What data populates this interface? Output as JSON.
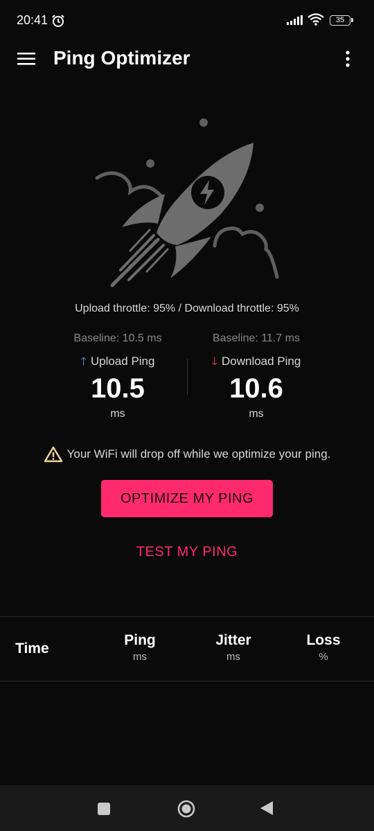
{
  "status_bar": {
    "time": "20:41",
    "battery": "35"
  },
  "app_bar": {
    "title": "Ping Optimizer"
  },
  "throttle_text": "Upload throttle: 95% / Download throttle: 95%",
  "upload": {
    "baseline": "Baseline: 10.5 ms",
    "label": "Upload Ping",
    "value": "10.5",
    "unit": "ms"
  },
  "download": {
    "baseline": "Baseline: 11.7 ms",
    "label": "Download Ping",
    "value": "10.6",
    "unit": "ms"
  },
  "warning": "Your WiFi will drop off while we optimize your ping.",
  "buttons": {
    "optimize": "OPTIMIZE MY PING",
    "test": "TEST MY PING"
  },
  "table": {
    "time": "Time",
    "ping": {
      "label": "Ping",
      "unit": "ms"
    },
    "jitter": {
      "label": "Jitter",
      "unit": "ms"
    },
    "loss": {
      "label": "Loss",
      "unit": "%"
    }
  },
  "colors": {
    "accent": "#ff2a6d",
    "upload_arrow": "#6f8cff",
    "download_arrow": "#ff3b5c",
    "background": "#0b0a0b"
  },
  "icons": [
    "alarm-icon",
    "signal-icon",
    "wifi-icon",
    "battery-icon",
    "menu-icon",
    "more-icon",
    "rocket-illustration",
    "warning-icon",
    "arrow-up-icon",
    "arrow-down-icon",
    "nav-recents-icon",
    "nav-home-icon",
    "nav-back-icon"
  ]
}
